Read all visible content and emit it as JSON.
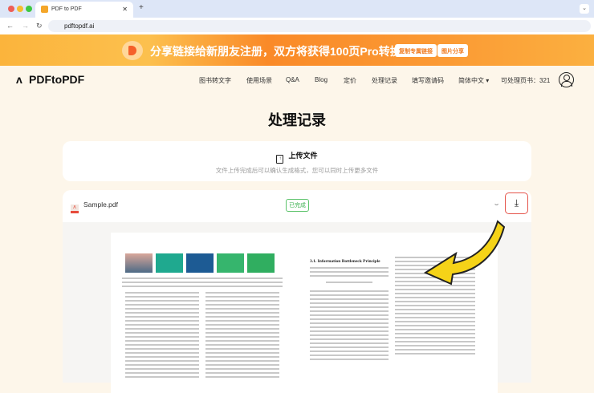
{
  "browser": {
    "tab_title": "PDF to PDF",
    "url": "pdftopdf.ai"
  },
  "banner": {
    "text": "分享链接给新朋友注册，双方将获得100页Pro转换",
    "copy_button": "复制专属链接",
    "share_button": "图片分享"
  },
  "nav": {
    "logo": "PDFtoPDF",
    "items": [
      "图书转文字",
      "使用场景",
      "Q&A",
      "Blog",
      "定价",
      "处理记录",
      "填写邀请码",
      "简体中文 ▾"
    ],
    "pages_left": "可处理页书：321"
  },
  "main": {
    "title": "处理记录",
    "upload": {
      "label": "上传文件",
      "hint": "文件上传完成后可以确认生成格式，您可以同时上传更多文件"
    },
    "file": {
      "name": "Sample.pdf",
      "status": "已完成",
      "status_color": "#3bb14f"
    },
    "preview": {
      "right_heading": "3.1. Information Bottleneck Principle"
    }
  },
  "colors": {
    "accent": "#f07a1e",
    "download_border": "#e5544a",
    "arrow": "#f5d318"
  }
}
